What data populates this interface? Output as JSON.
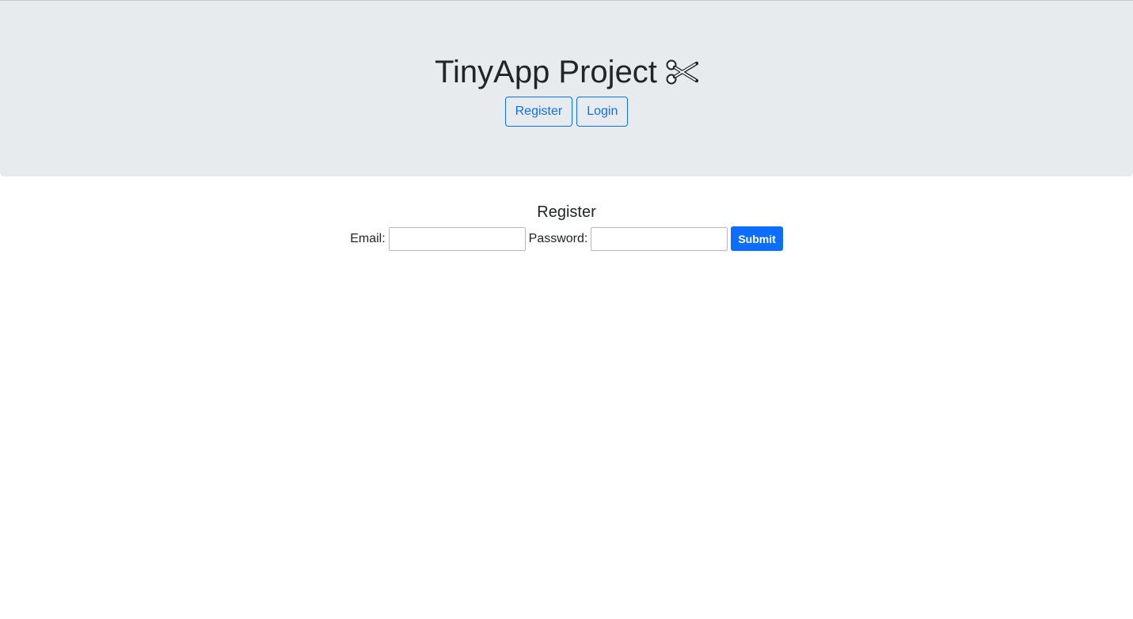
{
  "header": {
    "title": "TinyApp Project",
    "title_icon": "scissors-icon",
    "nav": {
      "register_label": "Register",
      "login_label": "Login"
    }
  },
  "register_form": {
    "title": "Register",
    "email_label": "Email:",
    "email_value": "",
    "password_label": "Password:",
    "password_value": "",
    "submit_label": "Submit"
  },
  "colors": {
    "header_background": "#e8ebee",
    "primary": "#0d6efd",
    "text": "#212529"
  }
}
